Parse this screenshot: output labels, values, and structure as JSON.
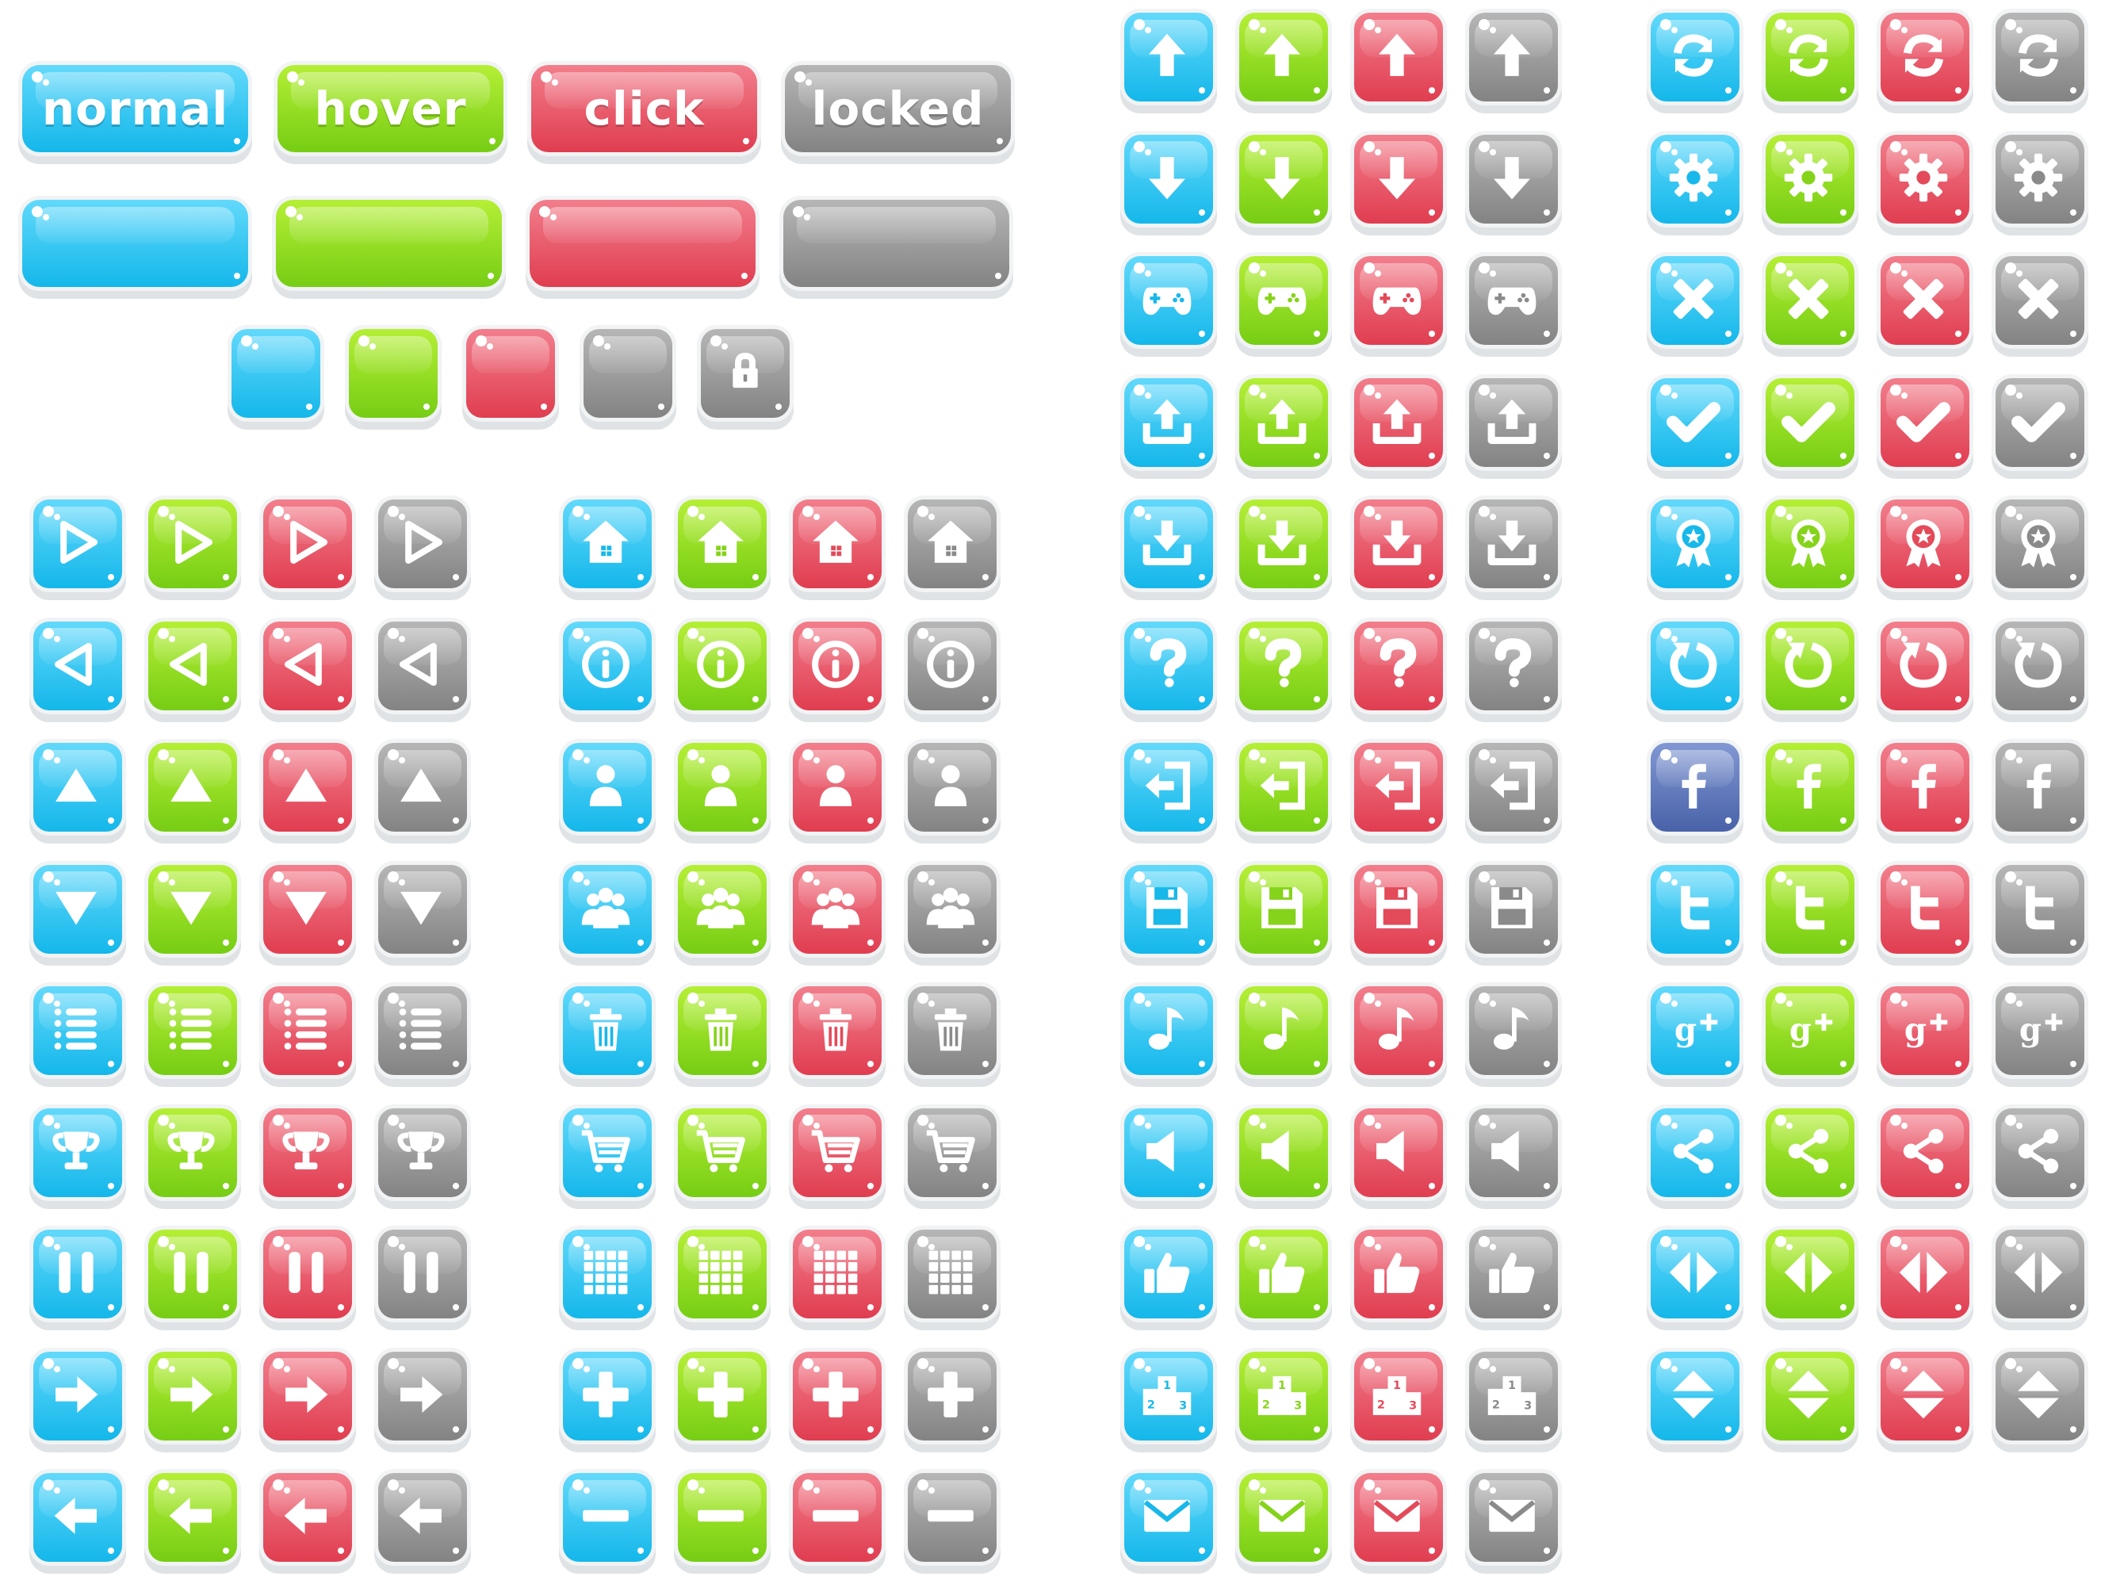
{
  "buttons": {
    "normal": "normal",
    "hover": "hover",
    "click": "click",
    "locked": "locked"
  },
  "palette": {
    "blue": "#18b8ea",
    "green": "#86d31b",
    "red": "#e34a5a",
    "gray": "#8a8a8a",
    "facebook": "#5068b0"
  },
  "icon_groups": [
    {
      "name": "left-column",
      "icons": [
        "play-icon",
        "back-icon",
        "up-triangle-icon",
        "down-triangle-icon",
        "list-icon",
        "trophy-icon",
        "pause-icon",
        "arrow-right-icon",
        "arrow-left-icon"
      ]
    },
    {
      "name": "second-column",
      "icons": [
        "home-icon",
        "info-icon",
        "user-icon",
        "group-icon",
        "trash-icon",
        "cart-icon",
        "grid-icon",
        "plus-icon",
        "minus-icon"
      ]
    },
    {
      "name": "third-column",
      "icons": [
        "arrow-up-icon",
        "arrow-down-icon",
        "gamepad-icon",
        "upload-icon",
        "download-icon",
        "question-icon",
        "exit-icon",
        "save-icon",
        "music-icon",
        "sound-icon",
        "like-icon",
        "podium-icon",
        "mail-icon"
      ]
    },
    {
      "name": "fourth-column",
      "icons": [
        "refresh-icon",
        "gear-icon",
        "close-icon",
        "check-icon",
        "medal-icon",
        "restart-icon",
        "facebook-icon",
        "twitter-icon",
        "google-plus-icon",
        "share-icon",
        "horizontal-arrows-icon",
        "vertical-arrows-icon"
      ]
    }
  ]
}
